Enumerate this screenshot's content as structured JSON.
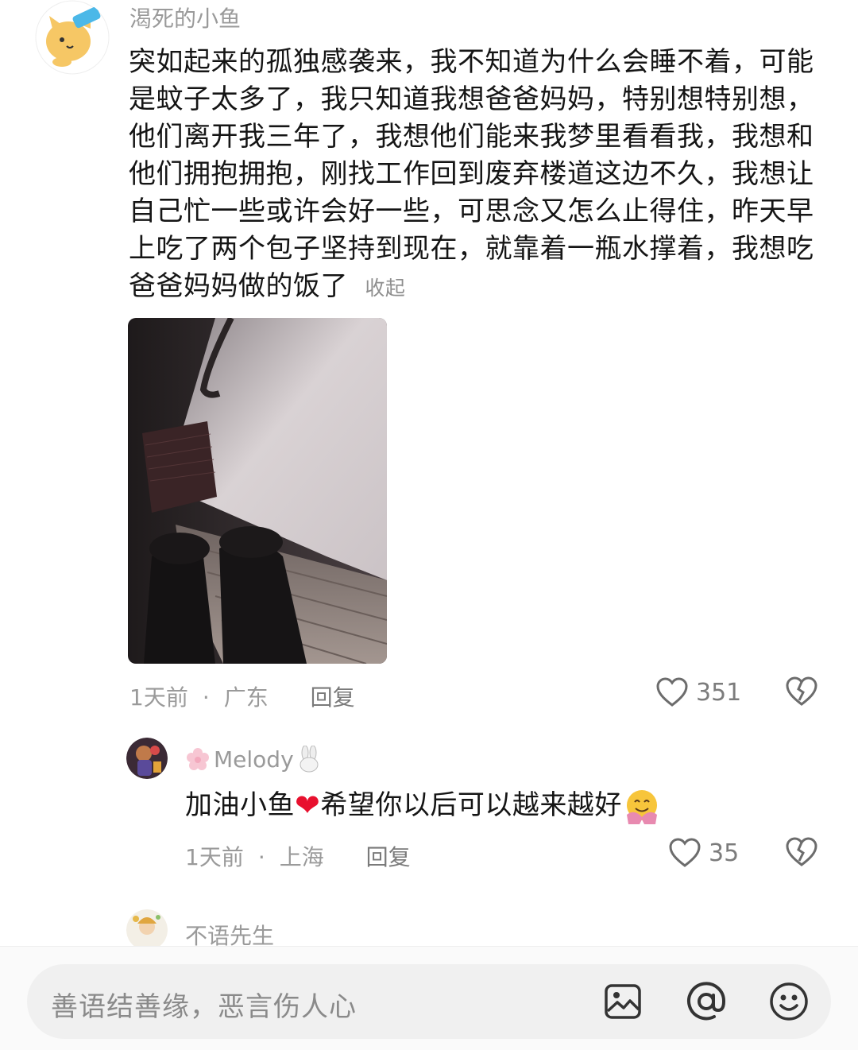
{
  "comment": {
    "username": "渴死的小鱼",
    "text": "突如起来的孤独感袭来，我不知道为什么会睡不着，可能是蚊子太多了，我只知道我想爸爸妈妈，特别想特别想，他们离开我三年了，我想他们能来我梦里看看我，我想和他们拥抱拥抱，刚找工作回到废弃楼道这边不久，我想让自己忙一些或许会好一些，可思念又怎么止得住，昨天早上吃了两个包子坚持到现在，就靠着一瓶水撑着，我想吃爸爸妈妈做的饭了",
    "text_lines": [
      "突如起来的孤独感袭来，我不知道为什么会睡不着，可能",
      "是蚊子太多了，我只知道我想爸爸妈妈，特别想特别想，",
      "他们离开我三年了，我想他们能来我梦里看看我，我想和",
      "他们拥抱拥抱，刚找工作回到废弃楼道这边不久，我想让",
      "自己忙一些或许会好一些，可思念又怎么止得住，昨天早",
      "上吃了两个包子坚持到现在，就靠着一瓶水撑着，我想吃",
      "爸爸妈妈做的饭了"
    ],
    "collapse_label": "收起",
    "time": "1天前",
    "location": "广东",
    "reply_label": "回复",
    "likes": "351",
    "separator": "·"
  },
  "reply": {
    "username": "Melody",
    "text_before": "加油小鱼",
    "text_after": "希望你以后可以越来越好",
    "heart_emoji": "❤",
    "time": "1天前",
    "location": "上海",
    "reply_label": "回复",
    "likes": "35",
    "separator": "·"
  },
  "next_comment": {
    "username": "不语先生"
  },
  "input": {
    "placeholder": "善语结善缘，恶言伤人心"
  },
  "icons": {
    "like": "heart-outline-icon",
    "dislike": "broken-heart-icon",
    "image": "image-icon",
    "mention": "at-icon",
    "emoji": "smiley-icon"
  },
  "colors": {
    "text": "#151515",
    "meta": "#9a9a9a",
    "heart_emoji": "#e8102e"
  }
}
